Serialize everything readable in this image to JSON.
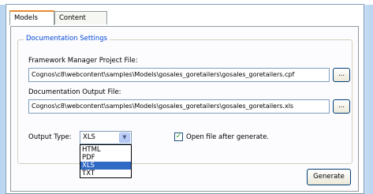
{
  "tabs": [
    {
      "label": "Models",
      "active": true
    },
    {
      "label": "Content Store",
      "active": false
    }
  ],
  "section_title": "Documentation Settings",
  "project_file": {
    "label": "Framework Manager Project File:",
    "value": "Cognos\\c8\\webcontent\\samples\\Models\\gosales_goretailers\\gosales_goretailers.cpf",
    "browse_label": "..."
  },
  "output_file": {
    "label": "Documentation Output File:",
    "value": "Cognos\\c8\\webcontent\\samples\\Models\\gosales_goretailers\\gosales_goretailers.xls",
    "browse_label": "..."
  },
  "output_type": {
    "label": "Output Type:",
    "selected": "XLS",
    "options": [
      "HTML",
      "PDF",
      "XLS",
      "TXT"
    ]
  },
  "open_after": {
    "label": "Open file after generate.",
    "checked": true,
    "check_glyph": "✓"
  },
  "generate_label": "Generate",
  "colors": {
    "accent": "#e68b2c",
    "legend": "#0046d5",
    "selection": "#316ac5"
  }
}
